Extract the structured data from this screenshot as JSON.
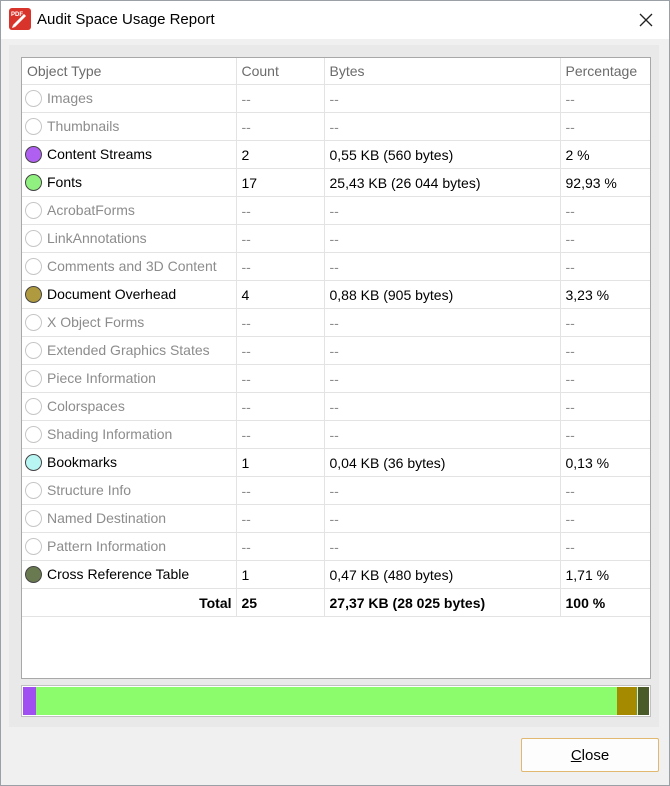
{
  "window": {
    "title": "Audit Space Usage Report",
    "app_icon_text": "PDF"
  },
  "table": {
    "headers": [
      "Object Type",
      "Count",
      "Bytes",
      "Percentage"
    ],
    "rows": [
      {
        "type": "Images",
        "count": "--",
        "bytes": "--",
        "pct": "--",
        "color": null
      },
      {
        "type": "Thumbnails",
        "count": "--",
        "bytes": "--",
        "pct": "--",
        "color": null
      },
      {
        "type": "Content Streams",
        "count": "2",
        "bytes": "0,55 KB (560 bytes)",
        "pct": "2 %",
        "color": "#b060f0"
      },
      {
        "type": "Fonts",
        "count": "17",
        "bytes": "25,43 KB (26 044 bytes)",
        "pct": "92,93 %",
        "color": "#90f080"
      },
      {
        "type": "AcrobatForms",
        "count": "--",
        "bytes": "--",
        "pct": "--",
        "color": null
      },
      {
        "type": "LinkAnnotations",
        "count": "--",
        "bytes": "--",
        "pct": "--",
        "color": null
      },
      {
        "type": "Comments and 3D Content",
        "count": "--",
        "bytes": "--",
        "pct": "--",
        "color": null
      },
      {
        "type": "Document Overhead",
        "count": "4",
        "bytes": "0,88 KB (905 bytes)",
        "pct": "3,23 %",
        "color": "#b09a40"
      },
      {
        "type": "X Object Forms",
        "count": "--",
        "bytes": "--",
        "pct": "--",
        "color": null
      },
      {
        "type": "Extended Graphics States",
        "count": "--",
        "bytes": "--",
        "pct": "--",
        "color": null
      },
      {
        "type": "Piece Information",
        "count": "--",
        "bytes": "--",
        "pct": "--",
        "color": null
      },
      {
        "type": "Colorspaces",
        "count": "--",
        "bytes": "--",
        "pct": "--",
        "color": null
      },
      {
        "type": "Shading Information",
        "count": "--",
        "bytes": "--",
        "pct": "--",
        "color": null
      },
      {
        "type": "Bookmarks",
        "count": "1",
        "bytes": "0,04 KB (36 bytes)",
        "pct": "0,13 %",
        "color": "#b8f6f4"
      },
      {
        "type": "Structure Info",
        "count": "--",
        "bytes": "--",
        "pct": "--",
        "color": null
      },
      {
        "type": "Named Destination",
        "count": "--",
        "bytes": "--",
        "pct": "--",
        "color": null
      },
      {
        "type": "Pattern Information",
        "count": "--",
        "bytes": "--",
        "pct": "--",
        "color": null
      },
      {
        "type": "Cross Reference Table",
        "count": "1",
        "bytes": "0,47 KB (480 bytes)",
        "pct": "1,71 %",
        "color": "#6a7a50"
      }
    ],
    "total": {
      "label": "Total",
      "count": "25",
      "bytes": "27,37 KB (28 025 bytes)",
      "pct": "100 %"
    }
  },
  "usage_bar": [
    {
      "name": "Content Streams",
      "fraction": 0.02,
      "color": "#a050f0"
    },
    {
      "name": "Fonts",
      "fraction": 0.9293,
      "color": "#8cfc6c"
    },
    {
      "name": "Document Overhead",
      "fraction": 0.0323,
      "color": "#a58a00"
    },
    {
      "name": "Bookmarks",
      "fraction": 0.0013,
      "color": "#b8f6f4"
    },
    {
      "name": "Cross Reference Table",
      "fraction": 0.0171,
      "color": "#4a5a28"
    }
  ],
  "footer": {
    "close_label": "Close"
  }
}
